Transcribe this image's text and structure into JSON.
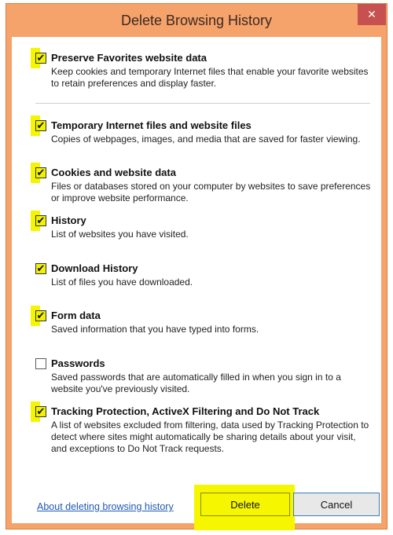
{
  "dialog": {
    "title": "Delete Browsing History",
    "close_label": "✕"
  },
  "items": [
    {
      "label": "Preserve Favorites website data",
      "checked": true,
      "description": "Keep cookies and temporary Internet files that enable your favorite websites to retain preferences and display faster."
    },
    {
      "label": "Temporary Internet files and website files",
      "checked": true,
      "description": "Copies of webpages, images, and media that are saved for faster viewing."
    },
    {
      "label": "Cookies and website data",
      "checked": true,
      "description": "Files or databases stored on your computer by websites to save preferences or improve website performance."
    },
    {
      "label": "History",
      "checked": true,
      "description": "List of websites you have visited."
    },
    {
      "label": "Download History",
      "checked": true,
      "description": "List of files you have downloaded."
    },
    {
      "label": "Form data",
      "checked": true,
      "description": "Saved information that you have typed into forms."
    },
    {
      "label": "Passwords",
      "checked": false,
      "description": "Saved passwords that are automatically filled in when you sign in to a website you've previously visited."
    },
    {
      "label": "Tracking Protection, ActiveX Filtering and Do Not Track",
      "checked": true,
      "description": "A list of websites excluded from filtering, data used by Tracking Protection to detect where sites might automatically be sharing details about your visit, and exceptions to Do Not Track requests."
    }
  ],
  "footer": {
    "about_link": "About deleting browsing history",
    "delete_label": "Delete",
    "cancel_label": "Cancel"
  },
  "colors": {
    "title_bar": "#f6a26b",
    "highlight": "#f5f500",
    "close_button": "#c75050",
    "link": "#1f5ab5"
  }
}
